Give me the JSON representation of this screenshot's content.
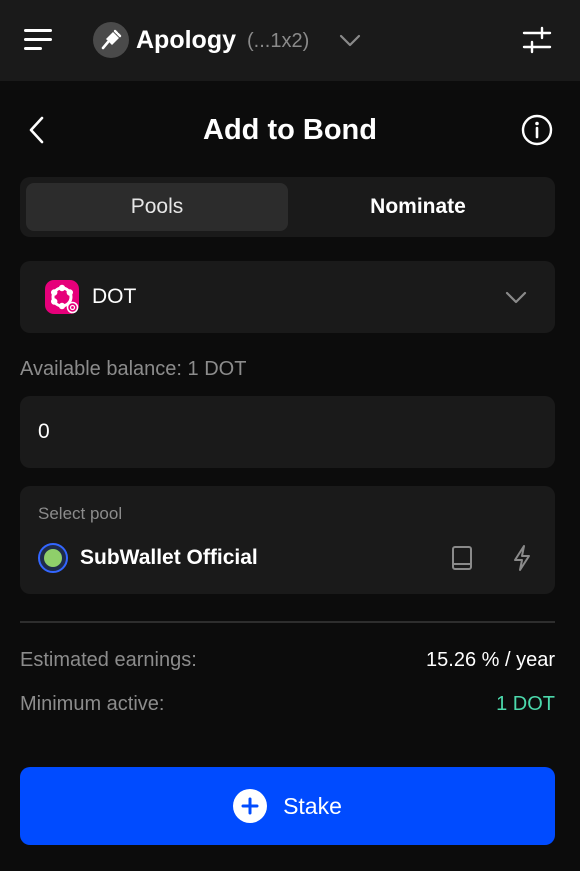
{
  "header": {
    "account_name": "Apology",
    "account_address": "(...1x2)",
    "icons": {
      "menu": "menu-icon",
      "account": "plug-icon",
      "chevron": "chevron-down-icon",
      "settings": "sliders-icon"
    }
  },
  "page": {
    "title": "Add to Bond",
    "icons": {
      "back": "chevron-left-icon",
      "info": "info-icon"
    }
  },
  "tabs": [
    {
      "label": "Pools",
      "active": true
    },
    {
      "label": "Nominate",
      "active": false
    }
  ],
  "token": {
    "symbol": "DOT",
    "icon": "polkadot-icon",
    "icon_color": "#e6007a"
  },
  "balance": {
    "text": "Available balance: 1 DOT"
  },
  "amount": {
    "value": "0"
  },
  "pool": {
    "caption": "Select pool",
    "name": "SubWallet Official",
    "icons": {
      "details": "book-icon",
      "auto_select": "lightning-icon"
    }
  },
  "summary": {
    "estimated_label": "Estimated earnings:",
    "estimated_value": "15.26 % / year",
    "minimum_label": "Minimum active:",
    "minimum_value": "1 DOT",
    "minimum_color": "#4cd9ac"
  },
  "action": {
    "stake_label": "Stake",
    "icon": "plus-circle-icon",
    "color": "#004bff"
  }
}
